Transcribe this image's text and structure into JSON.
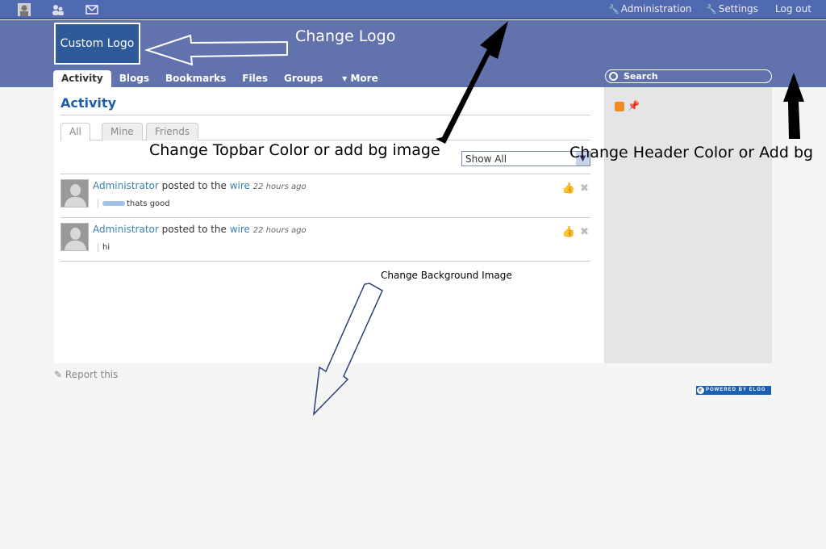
{
  "topbar": {
    "links": [
      "Administration",
      "Settings",
      "Log out"
    ]
  },
  "header": {
    "logo_text": "Custom Logo",
    "search_placeholder": "Search",
    "nav": [
      "Activity",
      "Blogs",
      "Bookmarks",
      "Files",
      "Groups",
      "▾ More"
    ]
  },
  "annotations": {
    "change_logo": "Change Logo",
    "change_topbar": "Change Topbar Color or add bg image",
    "change_header": "Change Header Color or Add bg",
    "change_background": "Change Background Image"
  },
  "main": {
    "title": "Activity",
    "tabs": [
      "All",
      "Mine",
      "Friends"
    ],
    "filter_value": "Show All",
    "items": [
      {
        "user": "Administrator",
        "verb": " posted to the ",
        "target": "wire",
        "time": "22 hours ago",
        "message": "thats good"
      },
      {
        "user": "Administrator",
        "verb": " posted to the ",
        "target": "wire",
        "time": "22 hours ago",
        "message": "hi"
      }
    ]
  },
  "footer": {
    "report": "Report this",
    "powered": "POWERED BY ELGG"
  },
  "colors": {
    "topbar": "#4f6ab0",
    "header": "#6272ad",
    "link": "#3b80ae",
    "title": "#1f5ea8"
  }
}
